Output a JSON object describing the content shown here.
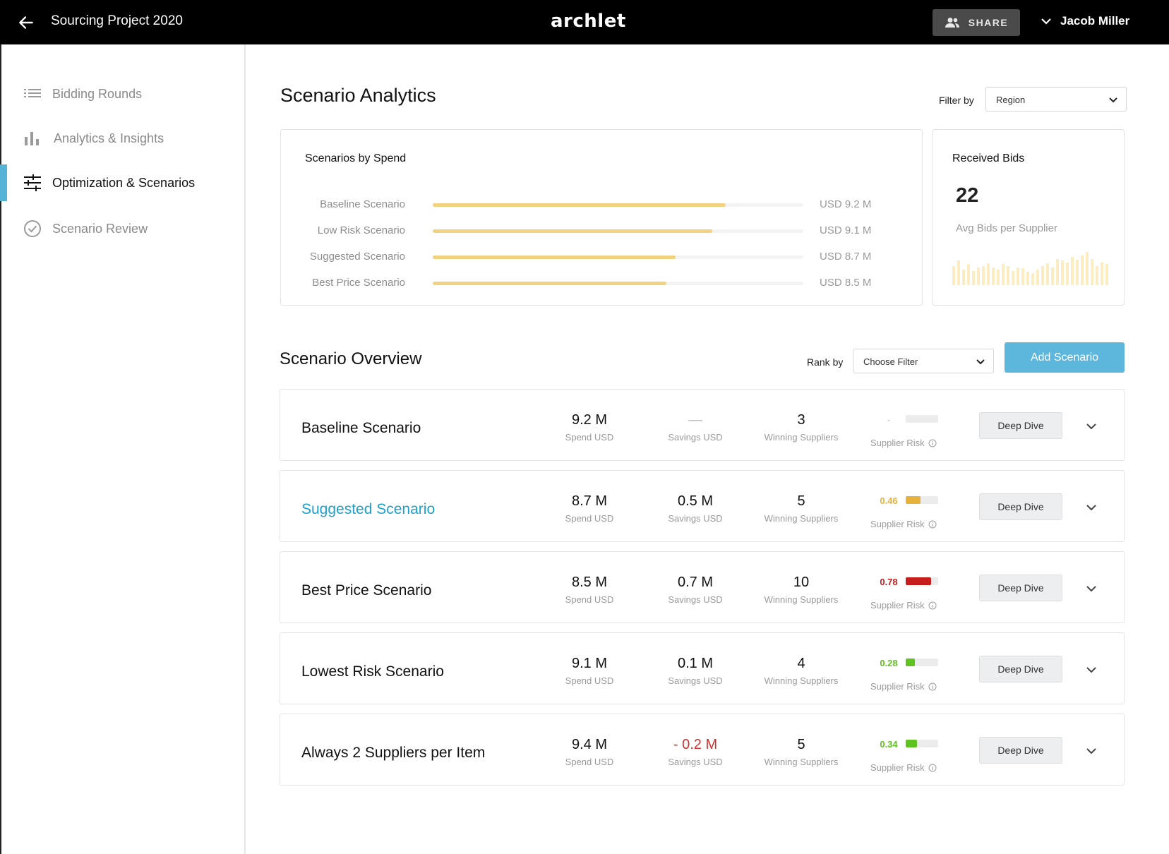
{
  "header": {
    "project_title": "Sourcing Project 2020",
    "logo_text": "archlet",
    "share_label": "SHARE",
    "user_name": "Jacob Miller",
    "bg_color": "#000000"
  },
  "sidebar": {
    "items": [
      {
        "label": "Bidding Rounds",
        "icon": "list-icon",
        "active": false
      },
      {
        "label": "Analytics & Insights",
        "icon": "bar-chart-icon",
        "active": false
      },
      {
        "label": "Optimization & Scenarios",
        "icon": "sliders-icon",
        "active": true
      },
      {
        "label": "Scenario Review",
        "icon": "check-circle-icon",
        "active": false
      }
    ],
    "accent_color": "#55b3d6"
  },
  "analytics": {
    "title": "Scenario Analytics",
    "filter_label": "Filter by",
    "filter_value": "Region"
  },
  "spend_card": {
    "title": "Scenarios by Spend",
    "rows": [
      {
        "name": "Baseline Scenario",
        "amount": "USD 9.2 M",
        "fraction": 0.79
      },
      {
        "name": "Low Risk Scenario",
        "amount": "USD 9.1 M",
        "fraction": 0.755
      },
      {
        "name": "Suggested Scenario",
        "amount": "USD 8.7 M",
        "fraction": 0.655
      },
      {
        "name": "Best Price Scenario",
        "amount": "USD 8.5 M",
        "fraction": 0.63
      }
    ]
  },
  "bids_card": {
    "title": "Received Bids",
    "count": "22",
    "subtitle": "Avg Bids per Supplier",
    "histogram": [
      0.55,
      0.7,
      0.45,
      0.6,
      0.4,
      0.5,
      0.55,
      0.62,
      0.5,
      0.45,
      0.6,
      0.55,
      0.4,
      0.5,
      0.48,
      0.38,
      0.35,
      0.45,
      0.55,
      0.62,
      0.5,
      0.75,
      0.7,
      0.65,
      0.8,
      0.72,
      0.85,
      0.95,
      0.75,
      0.55,
      0.65,
      0.6
    ]
  },
  "overview": {
    "title": "Scenario Overview",
    "rank_label": "Rank by",
    "rank_value": "Choose Filter",
    "add_label": "Add Scenario",
    "spend_label": "Spend USD",
    "savings_label": "Savings USD",
    "suppliers_label": "Winning Suppliers",
    "risk_label": "Supplier Risk",
    "deep_dive_label": "Deep Dive",
    "scenarios": [
      {
        "name": "Baseline Scenario",
        "spend": "9.2 M",
        "savings": "—",
        "suppliers": "3",
        "risk": "-",
        "risk_fraction": 0,
        "risk_color": "#cccccc",
        "highlight": false,
        "savings_negative": false,
        "savings_dash": true
      },
      {
        "name": "Suggested Scenario",
        "spend": "8.7 M",
        "savings": "0.5 M",
        "suppliers": "5",
        "risk": "0.46",
        "risk_fraction": 0.46,
        "risk_color": "#e8b23a",
        "highlight": true,
        "savings_negative": false,
        "savings_dash": false
      },
      {
        "name": "Best Price Scenario",
        "spend": "8.5 M",
        "savings": "0.7 M",
        "suppliers": "10",
        "risk": "0.78",
        "risk_fraction": 0.78,
        "risk_color": "#c81d1d",
        "highlight": false,
        "savings_negative": false,
        "savings_dash": false
      },
      {
        "name": "Lowest Risk Scenario",
        "spend": "9.1 M",
        "savings": "0.1 M",
        "suppliers": "4",
        "risk": "0.28",
        "risk_fraction": 0.28,
        "risk_color": "#5fc21f",
        "highlight": false,
        "savings_negative": false,
        "savings_dash": false
      },
      {
        "name": "Always 2 Suppliers per Item",
        "spend": "9.4 M",
        "savings": "- 0.2 M",
        "suppliers": "5",
        "risk": "0.34",
        "risk_fraction": 0.34,
        "risk_color": "#5fc21f",
        "highlight": false,
        "savings_negative": true,
        "savings_dash": false
      }
    ]
  }
}
